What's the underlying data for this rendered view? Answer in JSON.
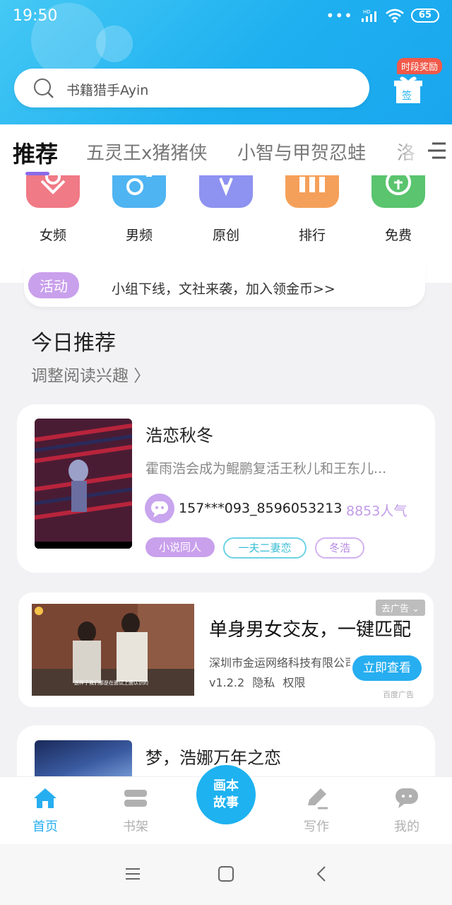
{
  "status_bar": {
    "time": "19:50",
    "network": "HD",
    "battery": "65"
  },
  "search": {
    "placeholder": "书籍猎手Ayin"
  },
  "reward": {
    "badge": "时段奖励",
    "gift_label": "签"
  },
  "tabs": [
    {
      "label": "推荐"
    },
    {
      "label": "五灵王x猪猪侠"
    },
    {
      "label": "小智与甲贺忍蛙"
    },
    {
      "label": "洛"
    }
  ],
  "categories": [
    {
      "label": "女频",
      "color": "#f07a86"
    },
    {
      "label": "男频",
      "color": "#4fb4f2"
    },
    {
      "label": "原创",
      "color": "#8e92f0"
    },
    {
      "label": "排行",
      "color": "#f5a05a"
    },
    {
      "label": "免费",
      "color": "#5ac46e"
    }
  ],
  "activity": {
    "badge": "活动",
    "text": "小组下线，文社来袭，加入领金币>>"
  },
  "section": {
    "title": "今日推荐",
    "subtitle": "调整阅读兴趣 〉"
  },
  "book_card": {
    "title": "浩恋秋冬",
    "description": "霍雨浩会成为鲲鹏复活王秋儿和王东儿...",
    "author": "157***093_8596053213",
    "popularity": "8853人气",
    "tags": [
      {
        "label": "小说同人",
        "style": "filled"
      },
      {
        "label": "一夫二妻恋",
        "style": "outline-cyan"
      },
      {
        "label": "冬浩",
        "style": "outline-purple"
      }
    ]
  },
  "ad": {
    "title": "单身男女交友，一键匹配",
    "company": "深圳市金运网络科技有限公司",
    "version": "v1.2.2",
    "privacy": "隐私",
    "permissions": "权限",
    "close_label": "去广告",
    "cta": "立即查看",
    "source": "百度广告",
    "caption": "这样子我们都是在面试上面认识的"
  },
  "book_card_2": {
    "title": "梦，浩娜万年之恋"
  },
  "bottom_nav": {
    "home": "首页",
    "shelf": "书架",
    "center_line1": "画本",
    "center_line2": "故事",
    "write": "写作",
    "me": "我的"
  },
  "colors": {
    "primary": "#1eb2f0",
    "accent_purple": "#c29be8"
  }
}
